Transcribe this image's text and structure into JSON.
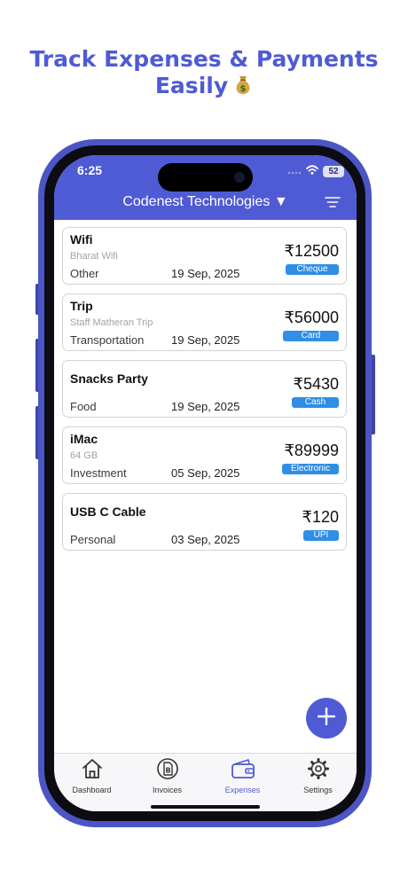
{
  "headline": {
    "line1": "Track Expenses & Payments",
    "line2": "Easily"
  },
  "status_bar": {
    "time": "6:25",
    "battery": "52"
  },
  "header": {
    "company": "Codenest Technologies ▼"
  },
  "expenses": [
    {
      "title": "Wifi",
      "subtitle": "Bharat Wifi",
      "category": "Other",
      "date": "19 Sep, 2025",
      "amount": "₹12500",
      "payment": "Cheque"
    },
    {
      "title": "Trip",
      "subtitle": "Staff Matheran Trip",
      "category": "Transportation",
      "date": "19 Sep, 2025",
      "amount": "₹56000",
      "payment": "Card"
    },
    {
      "title": "Snacks Party",
      "subtitle": "",
      "category": "Food",
      "date": "19 Sep, 2025",
      "amount": "₹5430",
      "payment": "Cash"
    },
    {
      "title": "iMac",
      "subtitle": "64 GB",
      "category": "Investment",
      "date": "05 Sep, 2025",
      "amount": "₹89999",
      "payment": "Electronic"
    },
    {
      "title": "USB C Cable",
      "subtitle": "",
      "category": "Personal",
      "date": "03 Sep, 2025",
      "amount": "₹120",
      "payment": "UPI"
    }
  ],
  "tabs": [
    {
      "label": "Dashboard",
      "icon": "house-icon"
    },
    {
      "label": "Invoices",
      "icon": "invoice-icon"
    },
    {
      "label": "Expenses",
      "icon": "wallet-icon",
      "active": true
    },
    {
      "label": "Settings",
      "icon": "gear-icon"
    }
  ],
  "colors": {
    "primary": "#4f5bd5",
    "badge": "#2f8ee5",
    "card_border": "#d2d3d8"
  }
}
